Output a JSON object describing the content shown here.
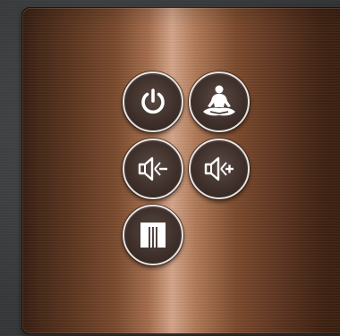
{
  "buttons": [
    {
      "name": "power-button",
      "icon": "power-icon"
    },
    {
      "name": "meditation-button",
      "icon": "meditation-icon"
    },
    {
      "name": "volume-down-button",
      "icon": "volume-down-icon"
    },
    {
      "name": "volume-up-button",
      "icon": "volume-up-icon"
    },
    {
      "name": "screen-button",
      "icon": "panel-icon"
    }
  ],
  "colors": {
    "button_border": "#e6e2df",
    "button_fill": "#3f302b",
    "icon": "#ffffff",
    "panel_highlight": "#d4a58a",
    "panel_dark": "#3a2114"
  }
}
